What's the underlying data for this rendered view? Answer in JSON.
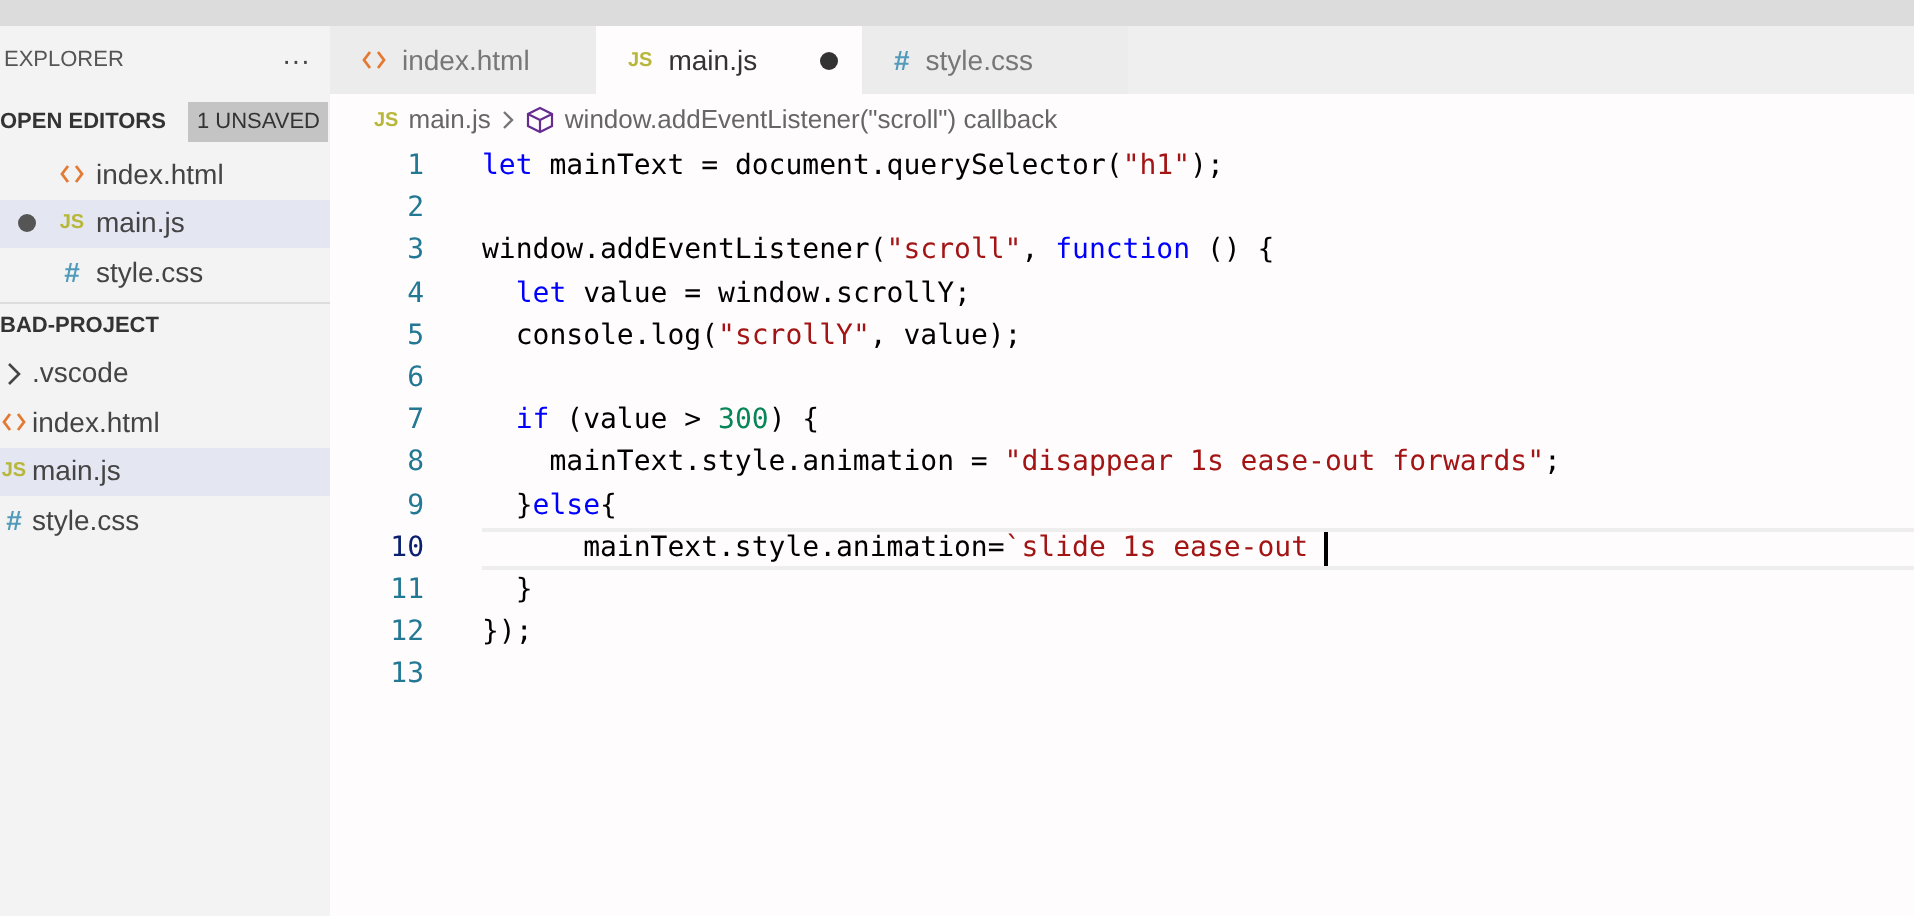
{
  "sidebar": {
    "title": "EXPLORER",
    "more": "···",
    "open_editors": {
      "title": "OPEN EDITORS",
      "badge": "1 UNSAVED",
      "items": [
        {
          "kind": "html",
          "name": "index.html",
          "unsaved": false,
          "selected": false
        },
        {
          "kind": "js",
          "icon_text": "JS",
          "name": "main.js",
          "unsaved": true,
          "selected": true
        },
        {
          "kind": "css",
          "icon_text": "#",
          "name": "style.css",
          "unsaved": false,
          "selected": false
        }
      ]
    },
    "project": {
      "title": "BAD-PROJECT",
      "items": [
        {
          "kind": "folder",
          "name": ".vscode",
          "selected": false
        },
        {
          "kind": "html",
          "name": "index.html",
          "selected": false
        },
        {
          "kind": "js",
          "icon_text": "JS",
          "name": "main.js",
          "selected": true
        },
        {
          "kind": "css",
          "icon_text": "#",
          "name": "style.css",
          "selected": false
        }
      ]
    }
  },
  "tabs": [
    {
      "kind": "html",
      "label": "index.html",
      "selected": false,
      "unsaved": false
    },
    {
      "kind": "js",
      "icon_text": "JS",
      "label": "main.js",
      "selected": true,
      "unsaved": true
    },
    {
      "kind": "css",
      "icon_text": "#",
      "label": "style.css",
      "selected": false,
      "unsaved": false
    }
  ],
  "breadcrumb": [
    {
      "kind": "js",
      "icon_text": "JS",
      "label": "main.js"
    },
    {
      "kind": "symbol",
      "label": "window.addEventListener(\"scroll\") callback"
    }
  ],
  "editor": {
    "lines": [
      {
        "number": "1",
        "current": false,
        "tokens": [
          {
            "kind": "keyword",
            "text": "let"
          },
          {
            "kind": "plain",
            "text": " mainText = document.querySelector("
          },
          {
            "kind": "string",
            "text": "\"h1\""
          },
          {
            "kind": "plain",
            "text": ");"
          }
        ]
      },
      {
        "number": "2",
        "current": false
      },
      {
        "number": "3",
        "current": false,
        "tokens": [
          {
            "kind": "plain",
            "text": "window.addEventListener("
          },
          {
            "kind": "string",
            "text": "\"scroll\""
          },
          {
            "kind": "plain",
            "text": ", "
          },
          {
            "kind": "keyword",
            "text": "function"
          },
          {
            "kind": "plain",
            "text": " () {"
          }
        ]
      },
      {
        "number": "4",
        "current": false,
        "tokens": [
          {
            "kind": "keyword",
            "text": "  let"
          },
          {
            "kind": "plain",
            "text": " value = window.scrollY;"
          }
        ]
      },
      {
        "number": "5",
        "current": false,
        "tokens": [
          {
            "kind": "plain",
            "text": "  console.log("
          },
          {
            "kind": "string",
            "text": "\"scrollY\""
          },
          {
            "kind": "plain",
            "text": ", value);"
          }
        ]
      },
      {
        "number": "6",
        "current": false
      },
      {
        "number": "7",
        "current": false,
        "tokens": [
          {
            "kind": "keyword",
            "text": "  if"
          },
          {
            "kind": "plain",
            "text": " (value > "
          },
          {
            "kind": "number",
            "text": "300"
          },
          {
            "kind": "plain",
            "text": ") {"
          }
        ]
      },
      {
        "number": "8",
        "current": false,
        "tokens": [
          {
            "kind": "plain",
            "text": "    mainText.style.animation = "
          },
          {
            "kind": "string",
            "text": "\"disappear 1s ease-out forwards\""
          },
          {
            "kind": "plain",
            "text": ";"
          }
        ]
      },
      {
        "number": "9",
        "current": false,
        "tokens": [
          {
            "kind": "plain",
            "text": "  }"
          },
          {
            "kind": "keyword",
            "text": "else"
          },
          {
            "kind": "plain",
            "text": "{"
          }
        ]
      },
      {
        "number": "10",
        "current": true,
        "tokens": [
          {
            "kind": "plain",
            "text": "      mainText.style.animation="
          },
          {
            "kind": "string",
            "text": "`slide 1s ease-out "
          }
        ]
      },
      {
        "number": "11",
        "current": false,
        "tokens": [
          {
            "kind": "plain",
            "text": "  }"
          }
        ]
      },
      {
        "number": "12",
        "current": false,
        "tokens": [
          {
            "kind": "plain",
            "text": "});"
          }
        ]
      },
      {
        "number": "13",
        "current": false
      }
    ]
  }
}
